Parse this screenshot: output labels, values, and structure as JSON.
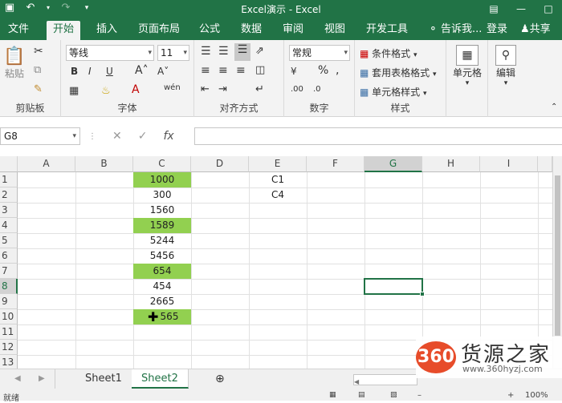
{
  "title": "Excel演示 - Excel",
  "tabs": [
    "文件",
    "开始",
    "插入",
    "页面布局",
    "公式",
    "数据",
    "审阅",
    "视图",
    "开发工具"
  ],
  "tell_me": "告诉我...",
  "login": "登录",
  "share": "共享",
  "ribbon": {
    "clipboard": {
      "label": "剪贴板",
      "paste": "粘贴"
    },
    "font": {
      "label": "字体",
      "name": "等线",
      "size": "11",
      "bold": "B",
      "italic": "I",
      "underline": "U"
    },
    "alignment": {
      "label": "对齐方式"
    },
    "number": {
      "label": "数字",
      "format": "常规"
    },
    "styles": {
      "label": "样式",
      "conditional": "条件格式",
      "table": "套用表格格式",
      "cell_styles": "单元格样式"
    },
    "cells": {
      "label": "单元格"
    },
    "editing": {
      "label": "编辑"
    }
  },
  "namebox": "G8",
  "columns": [
    "A",
    "B",
    "C",
    "D",
    "E",
    "F",
    "G",
    "H",
    "I"
  ],
  "rows": [
    "1",
    "2",
    "3",
    "4",
    "5",
    "6",
    "7",
    "8",
    "9",
    "10",
    "11",
    "12",
    "13"
  ],
  "cells": {
    "c1": "1000",
    "c2": "300",
    "c3": "1560",
    "c4": "1589",
    "c5": "5244",
    "c6": "5456",
    "c7": "654",
    "c8": "454",
    "c9": "2665",
    "c10": "565",
    "e1": "C1",
    "e2": "C4"
  },
  "highlight_color": "#92d050",
  "accent": "#217346",
  "sheets": [
    "Sheet1",
    "Sheet2"
  ],
  "status": "就绪",
  "zoom": "100%",
  "watermark": {
    "badge": "360",
    "name": "货源之家",
    "url": "www.360hyzj.com"
  }
}
